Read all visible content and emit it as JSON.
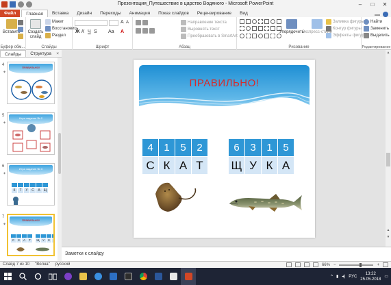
{
  "window": {
    "title": "Презентация_Путешествие в царство Водяного - Microsoft PowerPoint",
    "minimize": "–",
    "maximize": "□",
    "close": "✕"
  },
  "ribbon_tabs": [
    "Файл",
    "Главная",
    "Вставка",
    "Дизайн",
    "Переходы",
    "Анимация",
    "Показ слайдов",
    "Рецензирование",
    "Вид"
  ],
  "ribbon": {
    "clipboard": {
      "paste": "Вставить",
      "label": "Буфер обм..."
    },
    "slides": {
      "new_slide": "Создать слайд",
      "layout": "Макет",
      "reset": "Восстановить",
      "section": "Раздел",
      "label": "Слайды"
    },
    "font": {
      "label": "Шрифт",
      "bold": "Ж",
      "italic": "К",
      "underline": "Ч",
      "strike": "S",
      "size_up": "A",
      "size_down": "A",
      "case": "Aa"
    },
    "paragraph": {
      "text_direction": "Направление текста",
      "align_text": "Выровнять текст",
      "smartart": "Преобразовать в SmartArt",
      "label": "Абзац"
    },
    "drawing": {
      "arrange": "Упорядочить",
      "quick_styles": "Экспресс-стили",
      "fill": "Заливка фигуры",
      "outline": "Контур фигуры",
      "effects": "Эффекты фигур",
      "label": "Рисование"
    },
    "editing": {
      "find": "Найти",
      "replace": "Заменить",
      "select": "Выделить",
      "label": "Редактирование"
    }
  },
  "pane": {
    "tabs": [
      "Слайды",
      "Структура"
    ],
    "close": "×",
    "slides": [
      {
        "number": "4",
        "title": "ПРАВИЛЬНО!"
      },
      {
        "number": "5",
        "title": "Игра задание № 2"
      },
      {
        "number": "6",
        "title": "Игра задание № 3",
        "letters": [
          "К",
          "Т",
          "У",
          "С",
          "А",
          "Щ"
        ]
      },
      {
        "number": "7",
        "title": "ПРАВИЛЬНО!",
        "selected": true
      }
    ]
  },
  "slide": {
    "title": "ПРАВИЛЬНО!",
    "word1": {
      "numbers": [
        "4",
        "1",
        "5",
        "2"
      ],
      "letters": [
        "С",
        "К",
        "А",
        "Т"
      ],
      "image": "stingray"
    },
    "word2": {
      "numbers": [
        "6",
        "3",
        "1",
        "5"
      ],
      "letters": [
        "Щ",
        "У",
        "К",
        "А"
      ],
      "image": "pike"
    },
    "colors": {
      "title": "#d52b2b",
      "number_cell": "#2e97d6",
      "letter_cell": "#d4e6f6",
      "wave": "#3da4e0"
    }
  },
  "notes": {
    "placeholder": "Заметки к слайду"
  },
  "status": {
    "slide_info": "Слайд 7 из 10",
    "theme": "\"Волна\"",
    "language": "русский",
    "zoom": "66%"
  },
  "taskbar": {
    "language": "РУС",
    "time": "13:22",
    "date": "25.05.2018"
  }
}
